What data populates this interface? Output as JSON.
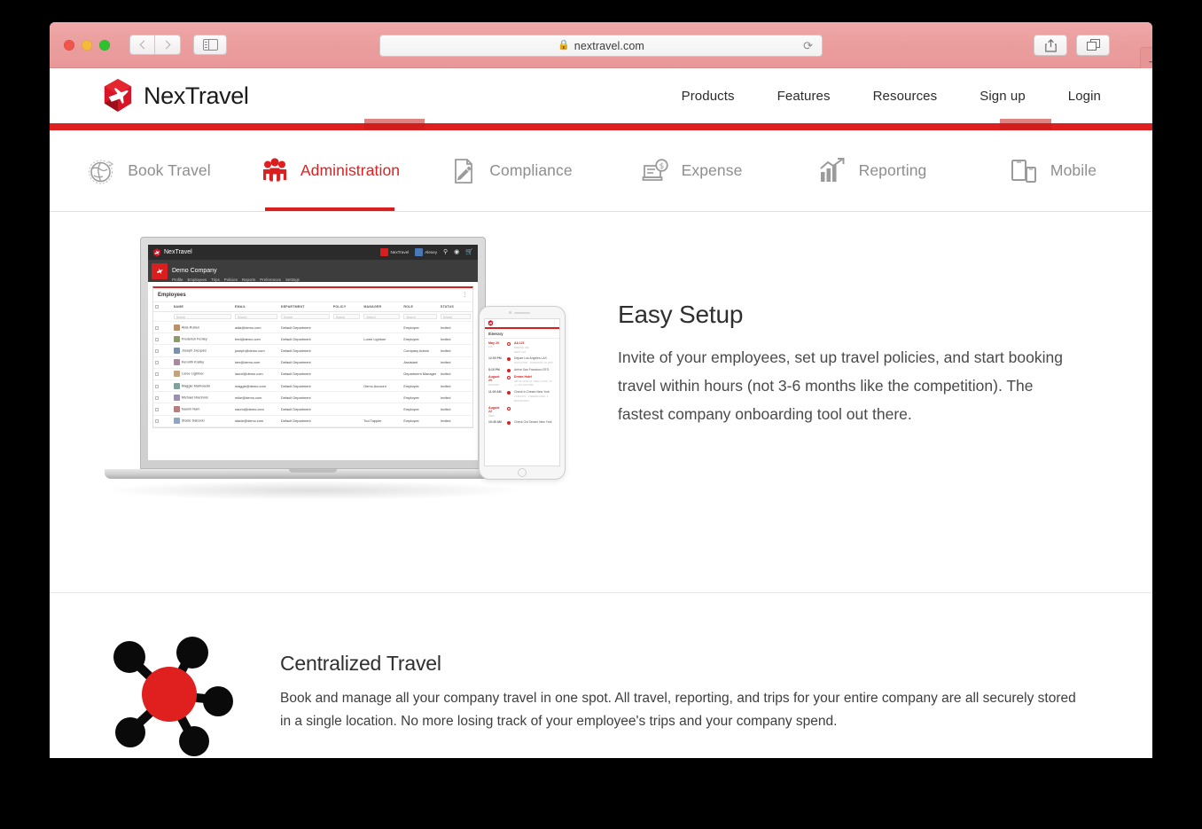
{
  "browser": {
    "url": "nextravel.com",
    "lock_icon": "lock-icon",
    "reload_icon": "reload-icon",
    "back_icon": "back-chevron-icon",
    "forward_icon": "forward-chevron-icon",
    "sidebar_icon": "sidebar-toggle-icon",
    "share_icon": "share-icon",
    "tabs_icon": "show-tabs-icon",
    "new_tab_label": "+"
  },
  "site": {
    "logo_text": "NexTravel",
    "nav": [
      {
        "label": "Products"
      },
      {
        "label": "Features"
      },
      {
        "label": "Resources"
      },
      {
        "label": "Sign up"
      },
      {
        "label": "Login"
      }
    ]
  },
  "product_tabs": [
    {
      "label": "Book Travel",
      "icon": "globe-icon",
      "active": false
    },
    {
      "label": "Administration",
      "icon": "people-group-icon",
      "active": true
    },
    {
      "label": "Compliance",
      "icon": "document-pen-icon",
      "active": false
    },
    {
      "label": "Expense",
      "icon": "receipt-dollar-icon",
      "active": false
    },
    {
      "label": "Reporting",
      "icon": "bar-chart-arrow-icon",
      "active": false
    },
    {
      "label": "Mobile",
      "icon": "tablet-phone-icon",
      "active": false
    }
  ],
  "sections": {
    "easy_setup": {
      "title": "Easy Setup",
      "body": "Invite of your employees, set up travel policies, and start booking travel within hours (not 3-6 months like the competition). The fastest company onboarding tool out there."
    },
    "centralized": {
      "title": "Centralized Travel",
      "body": "Book and manage all your company travel in one spot. All travel, reporting, and trips for your entire company are all securely stored in a single location. No more losing track of your employee's trips and your company spend.",
      "icon": "hub-network-icon"
    }
  },
  "app_mockup": {
    "brand": "NexTravel",
    "topbar_chips": [
      {
        "label": "NexTravel"
      },
      {
        "label": "Alexey"
      }
    ],
    "topbar_icons": [
      "search-icon",
      "globe-icon",
      "cart-icon"
    ],
    "company_name": "Demo Company",
    "company_nav": [
      "Profile",
      "Employees",
      "Trips",
      "Policies",
      "Reports",
      "Preferences",
      "Settings"
    ],
    "card_title": "Employees",
    "kebab_icon": "more-options-icon",
    "columns": [
      "NAME",
      "EMAIL",
      "DEPARTMENT",
      "POLICY",
      "MANAGER",
      "ROLE",
      "STATUS"
    ],
    "search_placeholder": "Search",
    "rows": [
      {
        "name": "Aida Ruben",
        "email": "aida@demo.com",
        "department": "Default Department",
        "policy": "",
        "manager": "",
        "role": "Employee",
        "status": "Invited"
      },
      {
        "name": "Frederick Fenley",
        "email": "fred@demo.com",
        "department": "Default Department",
        "policy": "",
        "manager": "Loree Lightner",
        "role": "Employee",
        "status": "Invited"
      },
      {
        "name": "Joseph Jacques",
        "email": "joseph@demo.com",
        "department": "Default Department",
        "policy": "",
        "manager": "",
        "role": "Company Admin",
        "status": "Invited"
      },
      {
        "name": "Kennith Kratky",
        "email": "ken@demo.com",
        "department": "Default Department",
        "policy": "",
        "manager": "",
        "role": "Assistant",
        "status": "Invited"
      },
      {
        "name": "Loree Lightner",
        "email": "laurel@demo.com",
        "department": "Default Department",
        "policy": "",
        "manager": "",
        "role": "Department Manager",
        "status": "Invited"
      },
      {
        "name": "Maggie Markowski",
        "email": "maggie@demo.com",
        "department": "Default Department",
        "policy": "",
        "manager": "Demo Account",
        "role": "Employee",
        "status": "Invited"
      },
      {
        "name": "Michael MacInnis",
        "email": "mike@demo.com",
        "department": "Default Department",
        "policy": "",
        "manager": "",
        "role": "Employee",
        "status": "Invited"
      },
      {
        "name": "Naomi Nam",
        "email": "naomi@demo.com",
        "department": "Default Department",
        "policy": "",
        "manager": "",
        "role": "Employee",
        "status": "Invited"
      },
      {
        "name": "Stacie Salcedo",
        "email": "stacie@demo.com",
        "department": "Default Department",
        "policy": "",
        "manager": "Tod Tappler",
        "role": "Employee",
        "status": "Invited"
      }
    ]
  },
  "phone_mockup": {
    "title": "Itinerary",
    "kebab_icon": "more-options-icon",
    "entries": [
      {
        "date": "May 20",
        "date_sub": "FRI",
        "time": "",
        "headline": "AA 123",
        "sub": "BOEING 380",
        "meta": "SEAT 14A",
        "type": "flight"
      },
      {
        "date": "",
        "date_sub": "",
        "time": "12:00 PM",
        "headline": "Depart Los Angeles LAX",
        "sub": "NON-STOP · DURATION 1H 20M",
        "meta": "",
        "type": "segment"
      },
      {
        "date": "",
        "date_sub": "",
        "time": "8:15 PM",
        "headline": "Arrive San Francisco SFO",
        "sub": "",
        "meta": "",
        "type": "segment"
      },
      {
        "date": "August 20",
        "date_sub": "MONDAY",
        "time": "",
        "headline": "Dream Hotel",
        "sub": "355 W 16TH ST, NEW YORK, NY",
        "meta": "+1 212 229 2559",
        "type": "hotel"
      },
      {
        "date": "",
        "date_sub": "",
        "time": "11:00 AM",
        "headline": "Check In Dream New York",
        "sub": "2 NIGHTS · 2 BEDROOMS, 1 BATHROOM",
        "meta": "",
        "type": "segment"
      },
      {
        "date": "August 22",
        "date_sub": "WED",
        "time": "",
        "headline": "",
        "sub": "",
        "meta": "",
        "type": "date"
      },
      {
        "date": "",
        "date_sub": "",
        "time": "10:45 AM",
        "headline": "Check Out Dream New York",
        "sub": "",
        "meta": "",
        "type": "segment"
      }
    ]
  },
  "colors": {
    "brand_red": "#d81e1e",
    "accent_red": "#e02020",
    "chrome_pink": "#eb9e9e",
    "text_dark": "#2f2f2f",
    "text_muted": "#8e8e8e"
  }
}
